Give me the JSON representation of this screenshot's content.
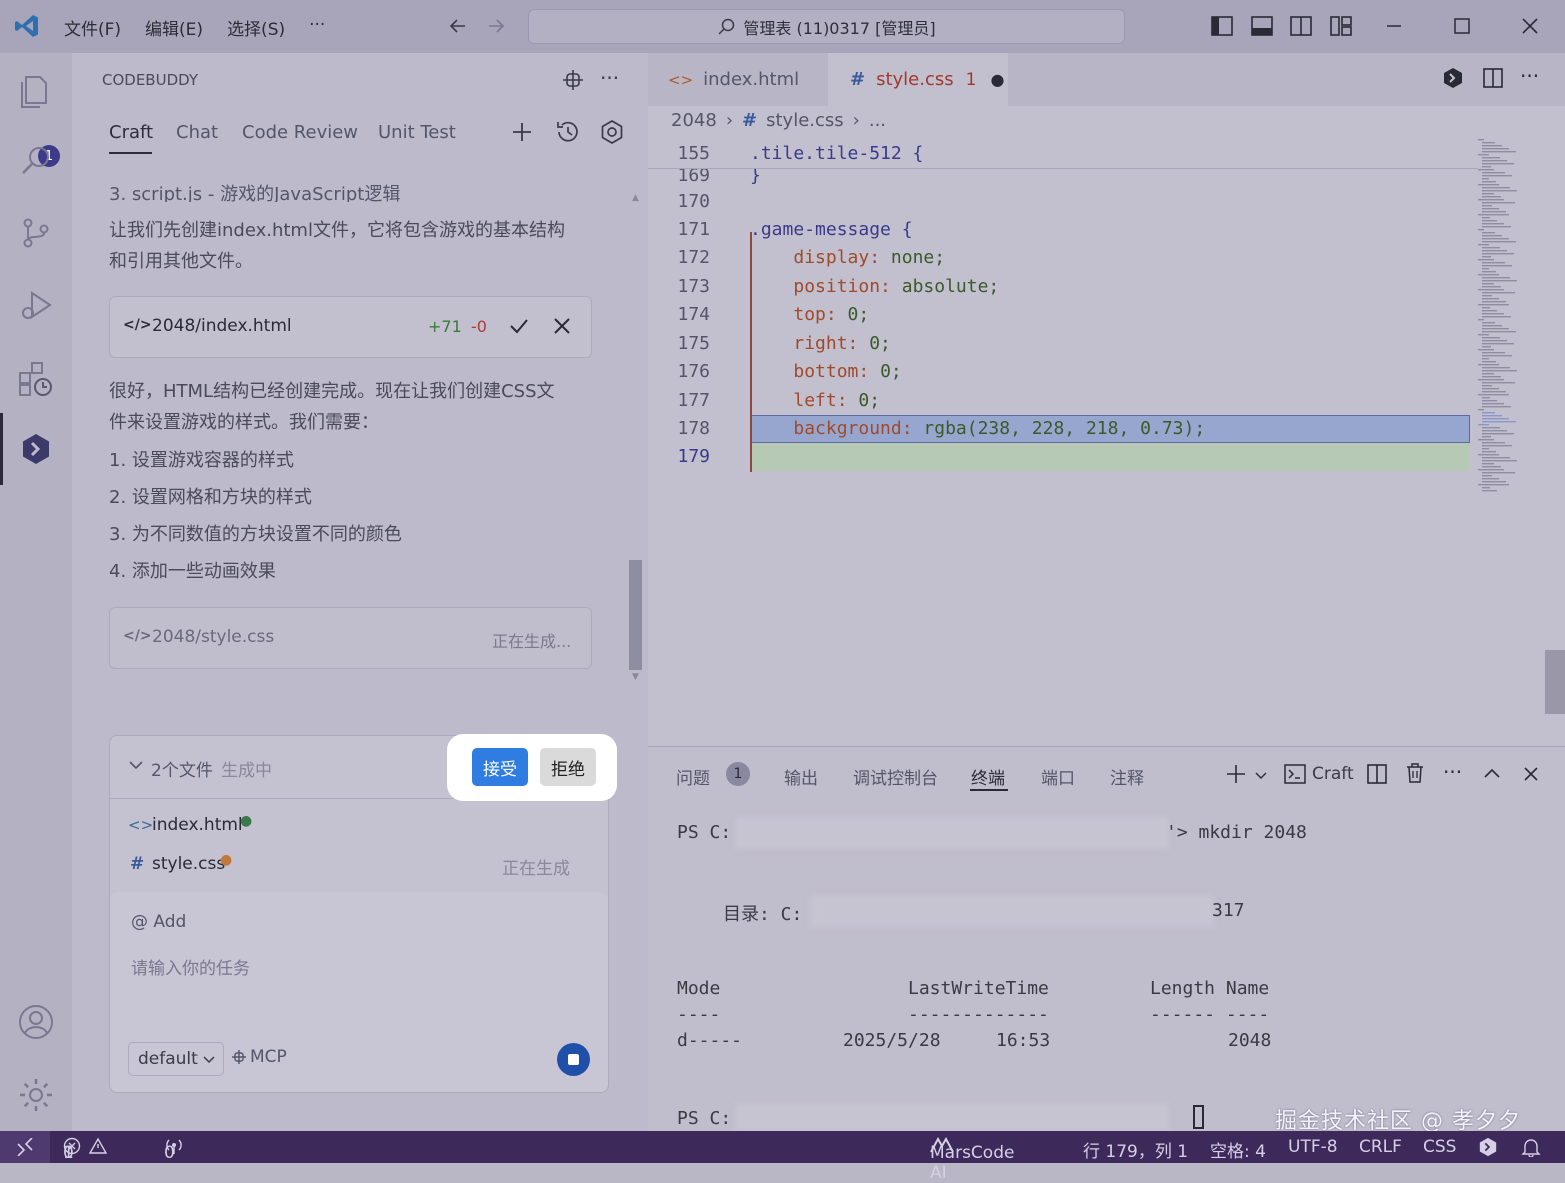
{
  "titlebar": {
    "menus": [
      "文件(F)",
      "编辑(E)",
      "选择(S)",
      "···"
    ],
    "search": "管理表 (11)0317 [管理员]"
  },
  "activity": {
    "scm_badge": "1"
  },
  "side": {
    "title": "CODEBUDDY",
    "tabs": [
      "Craft",
      "Chat",
      "Code Review",
      "Unit Test"
    ],
    "chat": {
      "cut_line": "3. script.js - 游戏的JavaScript逻辑",
      "para1": [
        "让我们先创建index.html文件，它将包含游戏的基本结构",
        "和引用其他文件。"
      ],
      "file_card": {
        "name": "2048/index.html",
        "added": "+71",
        "removed": "-0"
      },
      "para2": [
        "很好，HTML结构已经创建完成。现在让我们创建CSS文",
        "件来设置游戏的样式。我们需要："
      ],
      "list": [
        "1. 设置游戏容器的样式",
        "2. 设置网格和方块的样式",
        "3. 为不同数值的方块设置不同的颜色",
        "4. 添加一些动画效果"
      ],
      "gen_card": {
        "name": "2048/style.css",
        "status": "正在生成..."
      }
    },
    "pending": {
      "summary": "2个文件",
      "summary_status": "生成中",
      "accept": "接受",
      "reject": "拒绝",
      "files": [
        {
          "name": "index.html",
          "status": ""
        },
        {
          "name": "style.css",
          "status": "正在生成"
        }
      ]
    },
    "input": {
      "add": "@ Add",
      "placeholder": "请输入你的任务",
      "mode": "default",
      "mcp": "MCP"
    }
  },
  "editor": {
    "tabs": [
      {
        "label": "index.html"
      },
      {
        "label": "style.css",
        "problems": "1"
      }
    ],
    "breadcrumb": [
      "2048",
      "#",
      "style.css",
      "..."
    ],
    "sticky": {
      "line": "155",
      "text": ".tile.tile-512 {"
    },
    "lines": [
      {
        "n": "169",
        "t": "}"
      },
      {
        "n": "170",
        "t": ""
      },
      {
        "n": "171",
        "t": ".game-message {"
      },
      {
        "n": "172",
        "t": "    display: none;"
      },
      {
        "n": "173",
        "t": "    position: absolute;"
      },
      {
        "n": "174",
        "t": "    top: 0;"
      },
      {
        "n": "175",
        "t": "    right: 0;"
      },
      {
        "n": "176",
        "t": "    bottom: 0;"
      },
      {
        "n": "177",
        "t": "    left: 0;"
      },
      {
        "n": "178",
        "t": "    background: rgba(238, 228, 218, 0.73);"
      },
      {
        "n": "179",
        "t": ""
      }
    ]
  },
  "panel": {
    "tabs": [
      "问题",
      "输出",
      "调试控制台",
      "终端",
      "端口",
      "注释"
    ],
    "problems_badge": "1",
    "terminal_label": "Craft",
    "terminal": {
      "l1_prefix": "PS C:",
      "l1_suffix": "'> mkdir 2048",
      "l2_prefix": "目录: C:",
      "l2_suffix": "317",
      "headers": [
        "Mode",
        "LastWriteTime",
        "Length Name"
      ],
      "dashes": [
        "----",
        "-------------",
        "------ ----"
      ],
      "row": [
        "d-----",
        "2025/5/28",
        "16:53",
        "2048"
      ],
      "l_last": "PS C:"
    },
    "watermark": "掘金技术社区 @ 孝夕夕"
  },
  "status": {
    "errors": "1",
    "warnings": "0",
    "ports": "0",
    "ai": "MarsCode AI",
    "position": "行 179，列 1",
    "spaces": "空格: 4",
    "encoding": "UTF-8",
    "eol": "CRLF",
    "lang": "CSS"
  }
}
